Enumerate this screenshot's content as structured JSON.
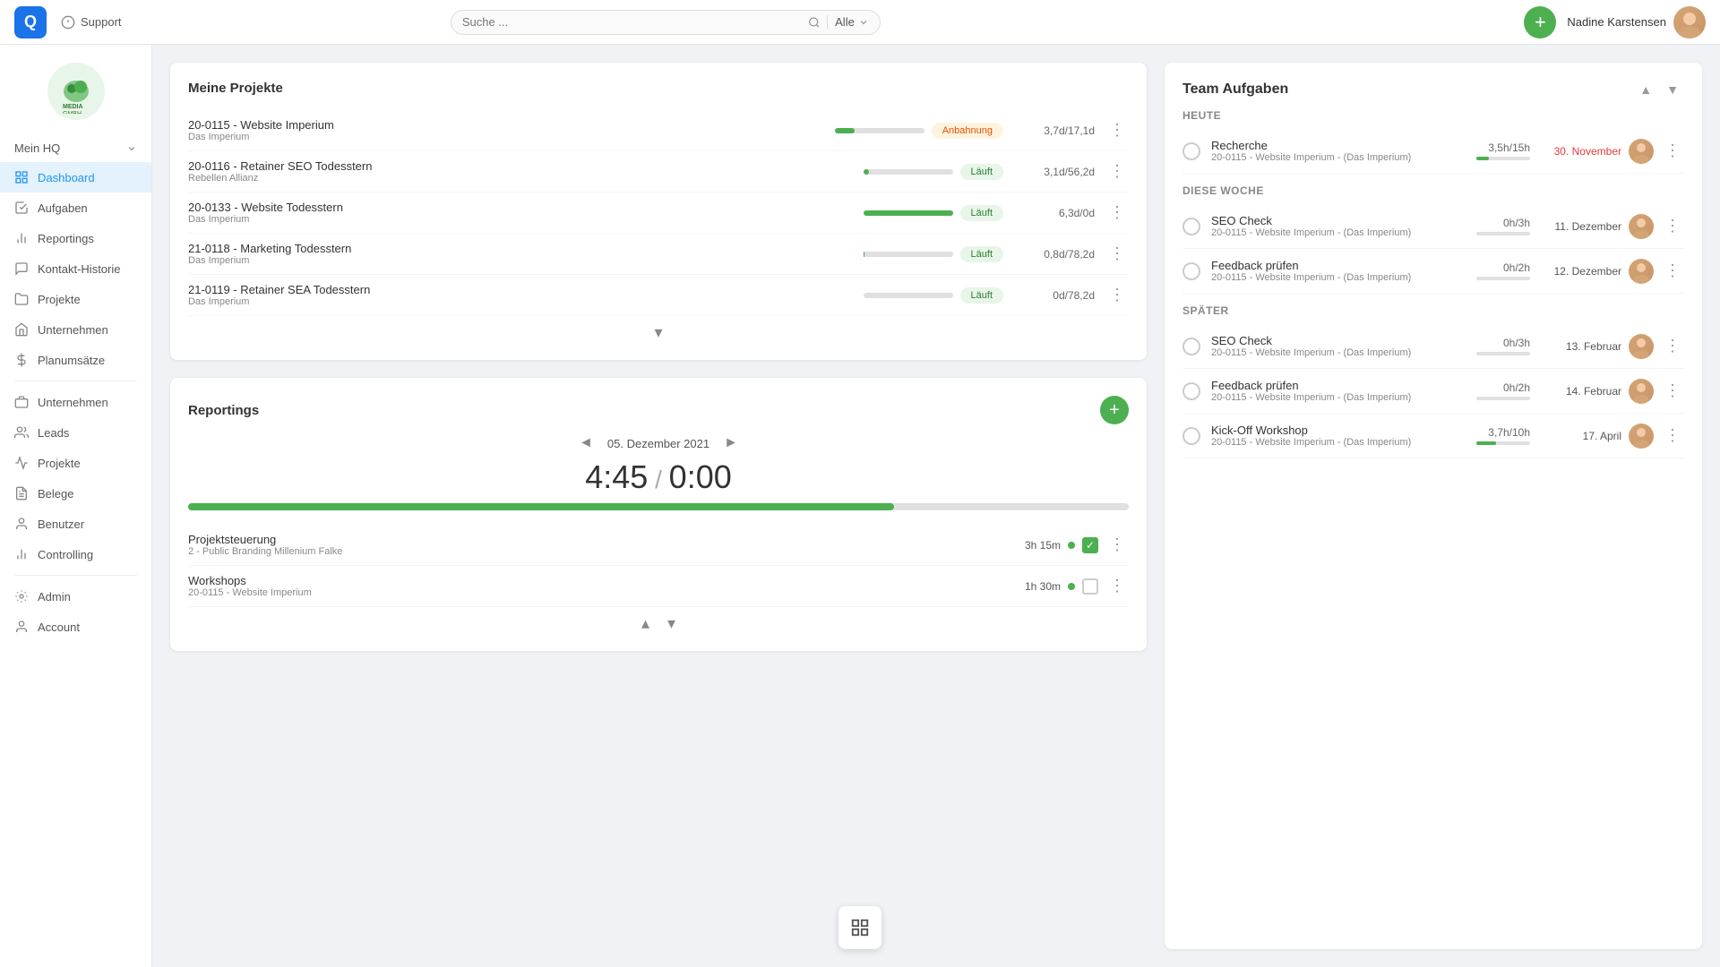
{
  "topbar": {
    "logo_text": "Q",
    "support_label": "Support",
    "search_placeholder": "Suche ...",
    "search_filter": "Alle",
    "add_button_label": "+",
    "user_name": "Nadine Karstensen"
  },
  "sidebar": {
    "mein_hq": "Mein HQ",
    "items": [
      {
        "id": "dashboard",
        "label": "Dashboard",
        "active": true
      },
      {
        "id": "aufgaben",
        "label": "Aufgaben",
        "active": false
      },
      {
        "id": "reportings",
        "label": "Reportings",
        "active": false
      },
      {
        "id": "kontakt-historie",
        "label": "Kontakt-Historie",
        "active": false
      },
      {
        "id": "projekte-top",
        "label": "Projekte",
        "active": false
      },
      {
        "id": "unternehmen-top",
        "label": "Unternehmen",
        "active": false
      },
      {
        "id": "planumstatze",
        "label": "Planumsätze",
        "active": false
      },
      {
        "id": "unternehmen",
        "label": "Unternehmen",
        "active": false
      },
      {
        "id": "leads",
        "label": "Leads",
        "active": false
      },
      {
        "id": "projekte",
        "label": "Projekte",
        "active": false
      },
      {
        "id": "belege",
        "label": "Belege",
        "active": false
      },
      {
        "id": "benutzer",
        "label": "Benutzer",
        "active": false
      },
      {
        "id": "controlling",
        "label": "Controlling",
        "active": false
      },
      {
        "id": "admin",
        "label": "Admin",
        "active": false
      },
      {
        "id": "account",
        "label": "Account",
        "active": false
      }
    ]
  },
  "meine_projekte": {
    "title": "Meine Projekte",
    "projects": [
      {
        "id": "20-0115",
        "name": "20-0115 - Website Imperium",
        "client": "Das Imperium",
        "status": "Anbahnung",
        "status_type": "anbahnung",
        "time": "3,7d/17,1d",
        "progress": 22
      },
      {
        "id": "20-0116",
        "name": "20-0116 - Retainer SEO Todesstern",
        "client": "Rebellen Allianz",
        "status": "Läuft",
        "status_type": "lauft",
        "time": "3,1d/56,2d",
        "progress": 6
      },
      {
        "id": "20-0133",
        "name": "20-0133 - Website Todesstern",
        "client": "Das Imperium",
        "status": "Läuft",
        "status_type": "lauft",
        "time": "6,3d/0d",
        "progress": 100
      },
      {
        "id": "21-0118",
        "name": "21-0118 - Marketing Todesstern",
        "client": "Das Imperium",
        "status": "Läuft",
        "status_type": "lauft",
        "time": "0,8d/78,2d",
        "progress": 1
      },
      {
        "id": "21-0119",
        "name": "21-0119 - Retainer SEA Todesstern",
        "client": "Das Imperium",
        "status": "Läuft",
        "status_type": "lauft",
        "time": "0d/78,2d",
        "progress": 0
      }
    ]
  },
  "reportings": {
    "title": "Reportings",
    "date": "05. Dezember 2021",
    "time_tracked": "4:45",
    "time_target": "0:00",
    "progress_percent": 75,
    "rows": [
      {
        "name": "Projektsteuerung",
        "sub": "2 - Public Branding Millenium Falke",
        "time": "3h 15m",
        "checked": true
      },
      {
        "name": "Workshops",
        "sub": "20-0115 - Website Imperium",
        "time": "1h 30m",
        "checked": false
      }
    ]
  },
  "team_aufgaben": {
    "title": "Team Aufgaben",
    "sections": [
      {
        "label": "Heute",
        "tasks": [
          {
            "name": "Recherche",
            "project": "20-0115 - Website Imperium - (Das Imperium)",
            "hours": "3,5h/15h",
            "progress": 23,
            "date": "30. November",
            "date_red": true
          }
        ]
      },
      {
        "label": "Diese Woche",
        "tasks": [
          {
            "name": "SEO Check",
            "project": "20-0115 - Website Imperium - (Das Imperium)",
            "hours": "0h/3h",
            "progress": 0,
            "date": "11. Dezember",
            "date_red": false
          },
          {
            "name": "Feedback prüfen",
            "project": "20-0115 - Website Imperium - (Das Imperium)",
            "hours": "0h/2h",
            "progress": 0,
            "date": "12. Dezember",
            "date_red": false
          }
        ]
      },
      {
        "label": "Später",
        "tasks": [
          {
            "name": "SEO Check",
            "project": "20-0115 - Website Imperium - (Das Imperium)",
            "hours": "0h/3h",
            "progress": 0,
            "date": "13. Februar",
            "date_red": false
          },
          {
            "name": "Feedback prüfen",
            "project": "20-0115 - Website Imperium - (Das Imperium)",
            "hours": "0h/2h",
            "progress": 0,
            "date": "14. Februar",
            "date_red": false
          },
          {
            "name": "Kick-Off Workshop",
            "project": "20-0115 - Website Imperium - (Das Imperium)",
            "hours": "3,7h/10h",
            "progress": 37,
            "date": "17. April",
            "date_red": false
          }
        ]
      }
    ]
  },
  "colors": {
    "green": "#4caf50",
    "blue": "#2196f3",
    "red": "#e53935",
    "orange": "#e65100"
  }
}
